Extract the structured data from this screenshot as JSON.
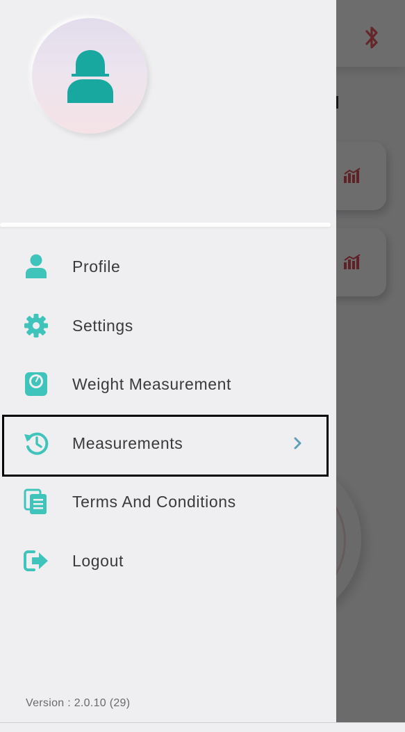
{
  "background": {
    "bluetooth_icon": "bluetooth-icon",
    "chart_icon": "bar-chart-icon"
  },
  "drawer": {
    "avatar_icon": "user-avatar-icon",
    "menu": [
      {
        "label": "Profile",
        "icon": "person-icon"
      },
      {
        "label": "Settings",
        "icon": "gear-icon"
      },
      {
        "label": "Weight Measurement",
        "icon": "scale-icon"
      },
      {
        "label": "Measurements",
        "icon": "history-icon",
        "selected": true
      },
      {
        "label": "Terms And Conditions",
        "icon": "document-icon"
      },
      {
        "label": "Logout",
        "icon": "logout-icon"
      }
    ],
    "version": "Version : 2.0.10 (29)"
  },
  "colors": {
    "accent": "#38bdb2",
    "icon_teal": "#3fc4bb",
    "text": "#3a3a3c",
    "chevron": "#5f9fb6",
    "overlay": "rgba(0,0,0,0.55)"
  }
}
